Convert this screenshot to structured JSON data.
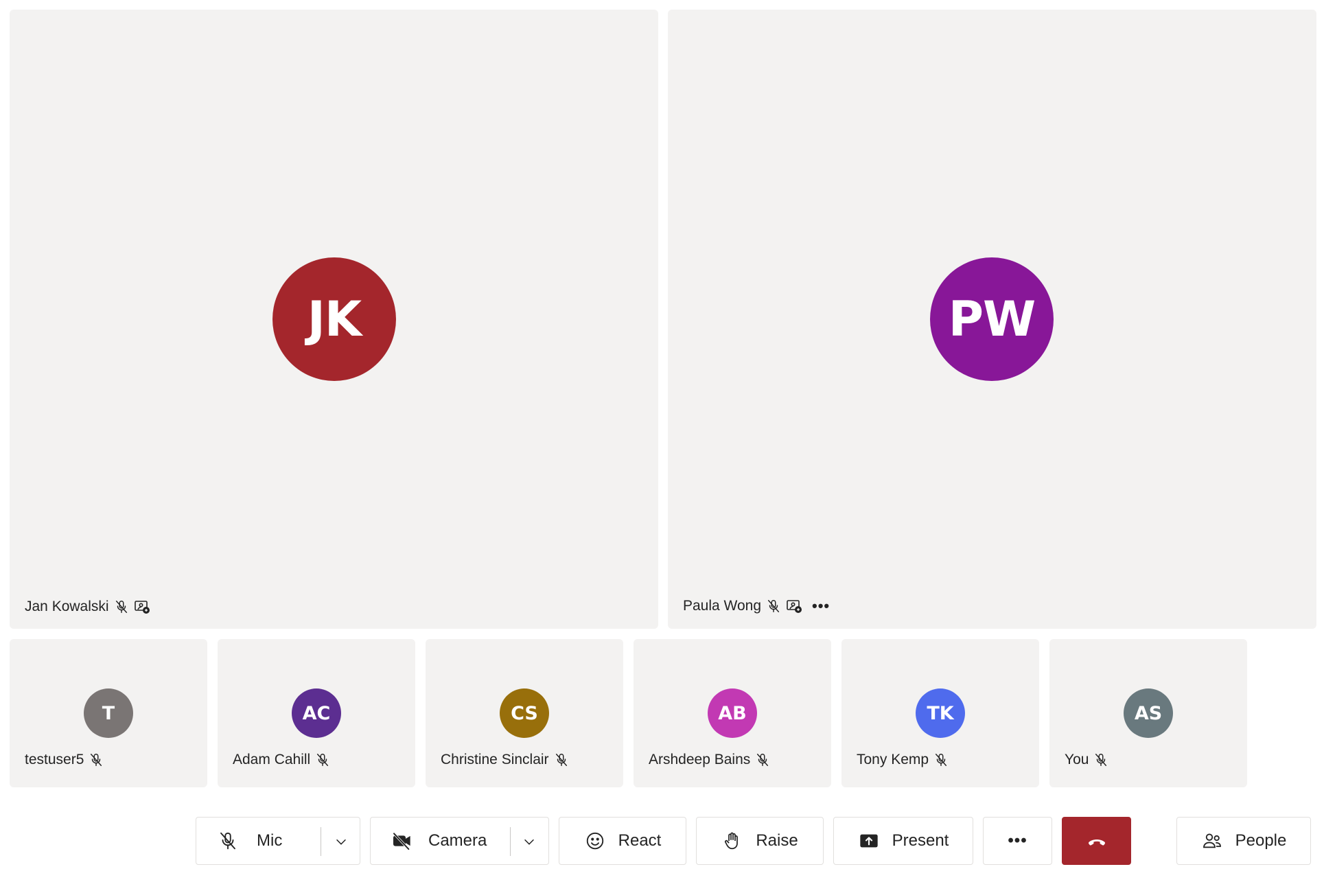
{
  "main_tiles": [
    {
      "initials": "JK",
      "name": "Jan Kowalski",
      "color": "#a4262c",
      "mic_icon": "mic-off-icon",
      "extra_icon": "spotlight-icon"
    },
    {
      "initials": "PW",
      "name": "Paula Wong",
      "color": "#881798",
      "mic_icon": "mic-off-icon",
      "extra_icon": "spotlight-icon",
      "more_label": "•••"
    }
  ],
  "gallery": [
    {
      "initials": "T",
      "name": "testuser5",
      "color": "#7a7574"
    },
    {
      "initials": "AC",
      "name": "Adam Cahill",
      "color": "#5c2e91"
    },
    {
      "initials": "CS",
      "name": "Christine Sinclair",
      "color": "#986f0b"
    },
    {
      "initials": "AB",
      "name": "Arshdeep Bains",
      "color": "#c239b3"
    },
    {
      "initials": "TK",
      "name": "Tony Kemp",
      "color": "#4f6bed"
    },
    {
      "initials": "AS",
      "name": "You",
      "color": "#69797e"
    }
  ],
  "toolbar": {
    "mic_label": "Mic",
    "camera_label": "Camera",
    "react_label": "React",
    "raise_label": "Raise",
    "present_label": "Present",
    "more_label": "•••",
    "people_label": "People",
    "hangup_color": "#a4262c"
  }
}
